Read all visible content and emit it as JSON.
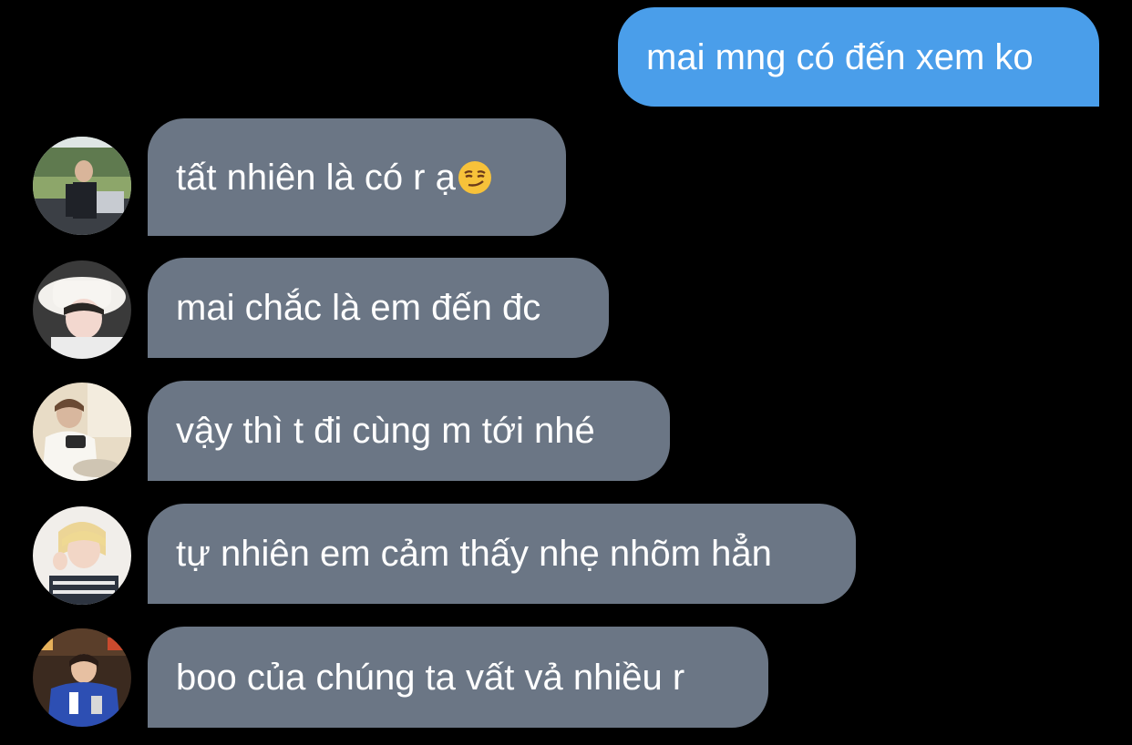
{
  "conversation": {
    "outgoing": [
      {
        "text": "mai mng có đến xem ko"
      }
    ],
    "incoming": [
      {
        "text": "tất nhiên là có r ạ",
        "emoji": "smirking-face",
        "avatar": "avatar-photo-1"
      },
      {
        "text": "mai chắc là em đến đc",
        "avatar": "avatar-photo-2"
      },
      {
        "text": "vậy thì t đi cùng m tới nhé",
        "avatar": "avatar-photo-3"
      },
      {
        "text": "tự nhiên em cảm thấy nhẹ nhõm hẳn",
        "avatar": "avatar-photo-4"
      },
      {
        "text": "boo của chúng ta vất vả nhiều r",
        "avatar": "avatar-photo-5"
      }
    ]
  },
  "colors": {
    "background": "#000000",
    "outgoing_bubble": "#4a9eea",
    "incoming_bubble": "#6b7685",
    "text": "#ffffff"
  }
}
